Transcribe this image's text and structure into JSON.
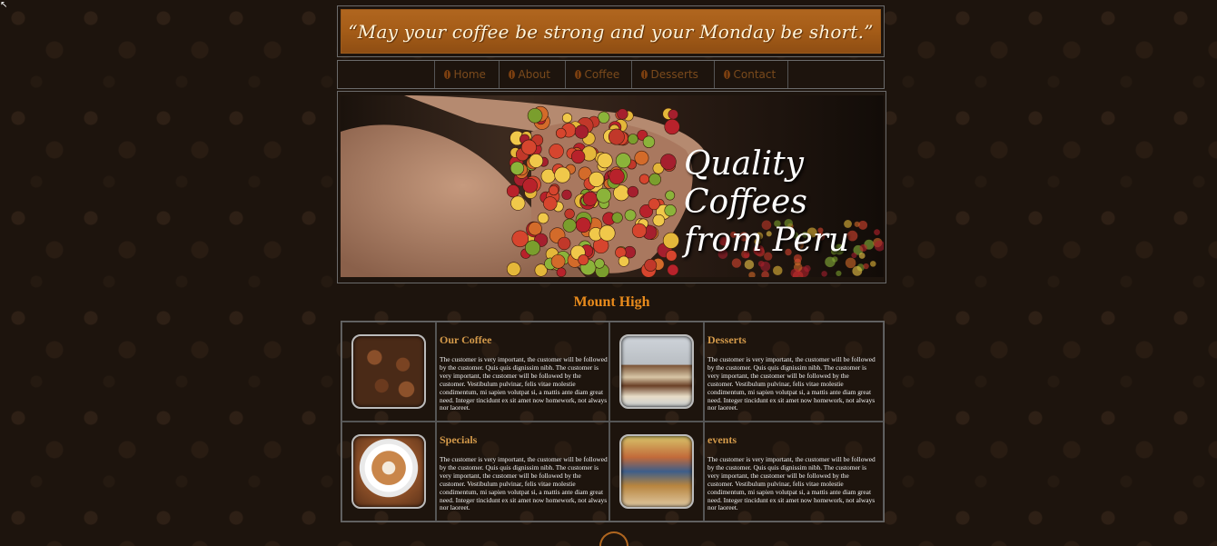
{
  "banner": {
    "tagline": "“May your coffee be strong and your Monday be short.”"
  },
  "nav": {
    "items": [
      {
        "label": "Home",
        "icon": "coffee-bean-icon"
      },
      {
        "label": "About",
        "icon": "coffee-bean-icon"
      },
      {
        "label": "Coffee",
        "icon": "coffee-bean-icon"
      },
      {
        "label": "Desserts",
        "icon": "coffee-bean-icon"
      },
      {
        "label": "Contact",
        "icon": "coffee-bean-icon"
      }
    ]
  },
  "hero": {
    "caption_line1": "Quality Coffees",
    "caption_line2": "from Peru"
  },
  "section": {
    "title": "Mount High"
  },
  "cards": [
    {
      "title": "Our Coffee",
      "text": "The customer is very important, the customer will be followed by the customer. Quis quis dignissim nibh. The customer is very important, the customer will be followed by the customer. Vestibulum pulvinar, felis vitae molestie condimentum, mi sapien volutpat si, a mattis ante diam great need. Integer tincidunt ex sit amet now homework, not always nor laoreet."
    },
    {
      "title": "Desserts",
      "text": "The customer is very important, the customer will be followed by the customer. Quis quis dignissim nibh. The customer is very important, the customer will be followed by the customer. Vestibulum pulvinar, felis vitae molestie condimentum, mi sapien volutpat si, a mattis ante diam great need. Integer tincidunt ex sit amet now homework, not always nor laoreet."
    },
    {
      "title": "Specials",
      "text": "The customer is very important, the customer will be followed by the customer. Quis quis dignissim nibh. The customer is very important, the customer will be followed by the customer. Vestibulum pulvinar, felis vitae molestie condimentum, mi sapien volutpat si, a mattis ante diam great need. Integer tincidunt ex sit amet now homework, not always nor laoreet."
    },
    {
      "title": "events",
      "text": "The customer is very important, the customer will be followed by the customer. Quis quis dignissim nibh. The customer is very important, the customer will be followed by the customer. Vestibulum pulvinar, felis vitae molestie condimentum, mi sapien volutpat si, a mattis ante diam great need. Integer tincidunt ex sit amet now homework, not always nor laoreet."
    }
  ],
  "colors": {
    "accent": "#e98b1c",
    "banner": "#a65d18",
    "card_title": "#d49a4a",
    "nav_text": "#7a4a1c",
    "background": "#1d140d"
  }
}
